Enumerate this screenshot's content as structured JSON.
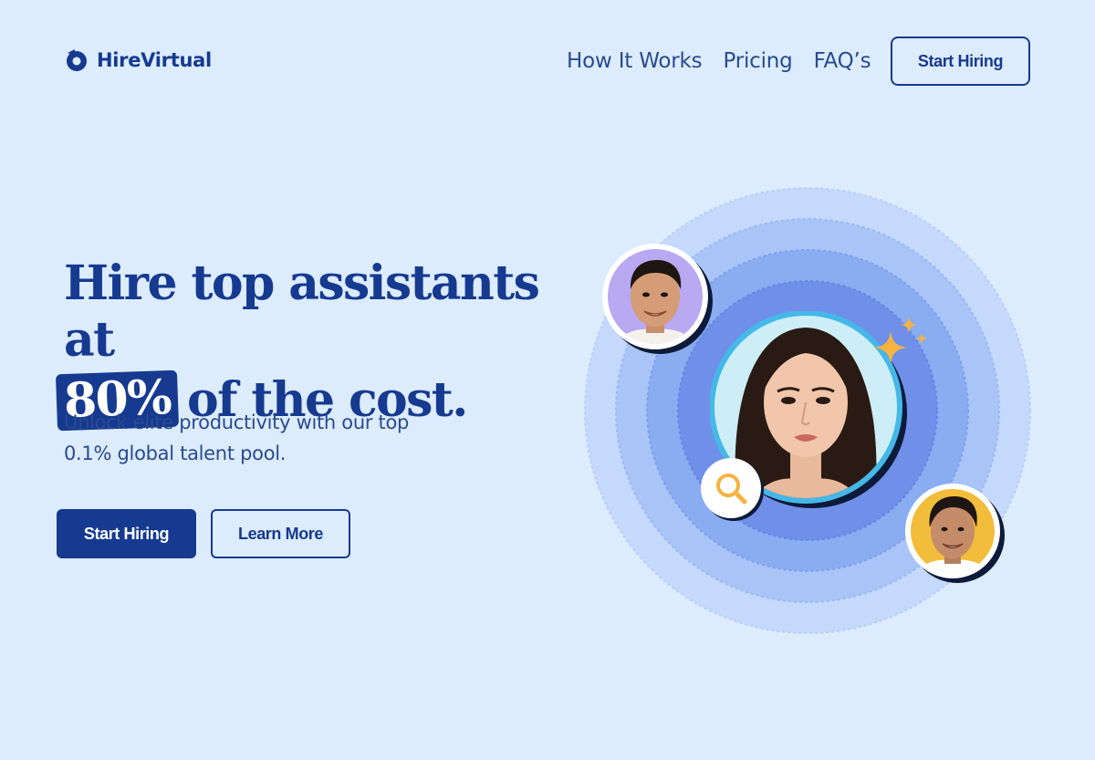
{
  "header": {
    "brand": "HireVirtual",
    "nav": [
      {
        "label": "How It Works"
      },
      {
        "label": "Pricing"
      },
      {
        "label": "FAQ’s"
      }
    ],
    "cta_label": "Start Hiring"
  },
  "hero": {
    "headline_line1": "Hire top assistants at",
    "headline_highlight": "80%",
    "headline_line2_rest": "of the cost.",
    "subtitle": "Unlock elite productivity with our top 0.1% global talent pool.",
    "primary_button": "Start Hiring",
    "secondary_button": "Learn More"
  },
  "illustration": {
    "icons": [
      "logo-icon",
      "search-icon",
      "sparkle-icon"
    ],
    "colors": {
      "brand": "#163a90",
      "background": "#dcecfd",
      "ring_outer": "#c4d9fb",
      "ring_mid": "#a9c4f6",
      "ring_inner": "#8aacf0",
      "ring_core": "#6f8fe8",
      "accent_cyan": "#44b8e8",
      "avatar_purple_bg": "#b9a8f2",
      "avatar_yellow_bg": "#f2bd3b",
      "sparkle": "#f5b342"
    }
  }
}
